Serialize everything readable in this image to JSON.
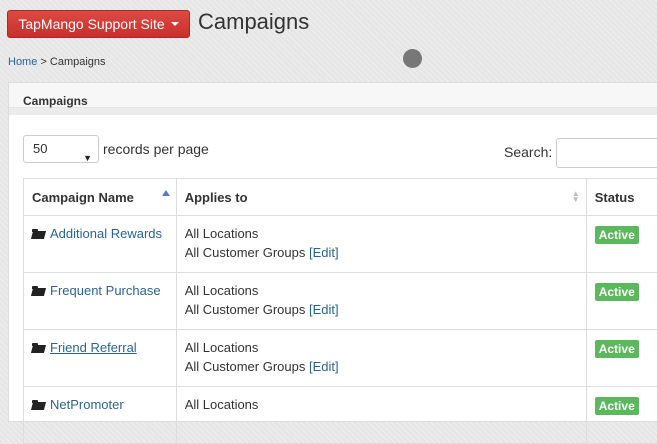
{
  "header": {
    "site_button": "TapMango Support Site",
    "title": "Campaigns"
  },
  "breadcrumb": {
    "home": "Home",
    "separator": " > ",
    "current": "Campaigns"
  },
  "panel": {
    "title": "Campaigns",
    "length_select": {
      "value": "50",
      "label": "records per page"
    },
    "search": {
      "label": "Search:",
      "value": ""
    },
    "columns": [
      {
        "label": "Campaign Name",
        "sort": "asc"
      },
      {
        "label": "Applies to",
        "sort": "both"
      },
      {
        "label": "Status"
      }
    ],
    "rows": [
      {
        "name": "Additional Rewards",
        "locations": "All Locations",
        "groups": "All Customer Groups",
        "edit": "[Edit]",
        "status": "Active"
      },
      {
        "name": "Frequent Purchase",
        "locations": "All Locations",
        "groups": "All Customer Groups",
        "edit": "[Edit]",
        "status": "Active"
      },
      {
        "name": "Friend Referral",
        "locations": "All Locations",
        "groups": "All Customer Groups",
        "edit": "[Edit]",
        "status": "Active"
      },
      {
        "name": "NetPromoter",
        "locations": "All Locations",
        "groups": "",
        "edit": "",
        "status": "Active"
      }
    ]
  },
  "colors": {
    "primary_button": "#c9302c",
    "link": "#2a6496",
    "status_active": "#5cb85c"
  },
  "icons": {
    "site_button": "caret-down-icon",
    "row": "folder-open-icon",
    "loading": "spinner-icon"
  }
}
